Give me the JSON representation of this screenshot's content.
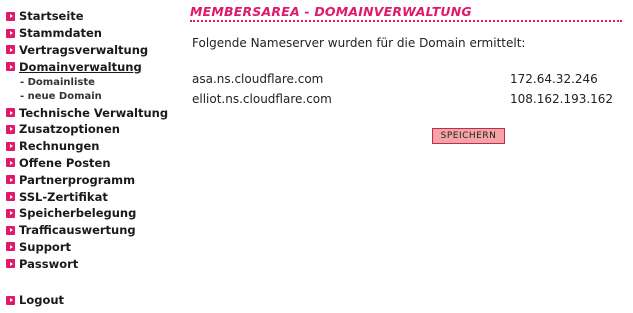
{
  "sidebar": {
    "items": [
      {
        "label": "Startseite"
      },
      {
        "label": "Stammdaten"
      },
      {
        "label": "Vertragsverwaltung"
      },
      {
        "label": "Domainverwaltung"
      },
      {
        "label": "Technische Verwaltung"
      },
      {
        "label": "Zusatzoptionen"
      },
      {
        "label": "Rechnungen"
      },
      {
        "label": "Offene Posten"
      },
      {
        "label": "Partnerprogramm"
      },
      {
        "label": "SSL-Zertifikat"
      },
      {
        "label": "Speicherbelegung"
      },
      {
        "label": "Trafficauswertung"
      },
      {
        "label": "Support"
      },
      {
        "label": "Passwort"
      }
    ],
    "subitems": [
      {
        "label": "- Domainliste"
      },
      {
        "label": "- neue Domain"
      }
    ],
    "logout": "Logout"
  },
  "main": {
    "title": "MEMBERSAREA - DOMAINVERWALTUNG",
    "intro": "Folgende Nameserver wurden für die Domain ermittelt:",
    "nameservers": [
      {
        "host": "asa.ns.cloudflare.com",
        "ip": "172.64.32.246"
      },
      {
        "host": "elliot.ns.cloudflare.com",
        "ip": "108.162.193.162"
      }
    ],
    "save_label": "SPEICHERN"
  },
  "colors": {
    "accent": "#e0196b",
    "button_bg": "#f4a3a7"
  }
}
